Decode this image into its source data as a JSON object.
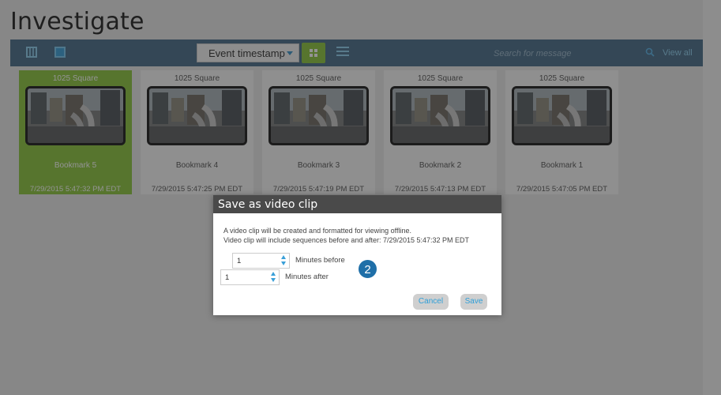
{
  "title": "Investigate",
  "toolbar": {
    "sort_label": "Event timestamp",
    "search_placeholder": "Search for message",
    "view_all": "View all"
  },
  "cards": [
    {
      "camera": "1025 Square",
      "name": "Bookmark 5",
      "time": "7/29/2015 5:47:32 PM EDT",
      "selected": true
    },
    {
      "camera": "1025 Square",
      "name": "Bookmark 4",
      "time": "7/29/2015 5:47:25 PM EDT",
      "selected": false
    },
    {
      "camera": "1025 Square",
      "name": "Bookmark 3",
      "time": "7/29/2015 5:47:19 PM EDT",
      "selected": false
    },
    {
      "camera": "1025 Square",
      "name": "Bookmark 2",
      "time": "7/29/2015 5:47:13 PM EDT",
      "selected": false
    },
    {
      "camera": "1025 Square",
      "name": "Bookmark 1",
      "time": "7/29/2015 5:47:05 PM EDT",
      "selected": false
    }
  ],
  "dialog": {
    "title": "Save as video clip",
    "line1": "A video clip will be created and formatted for viewing offline.",
    "line2": "Video clip will include sequences before and after: 7/29/2015 5:47:32 PM EDT",
    "before_value": "1",
    "before_label": "Minutes before",
    "after_value": "1",
    "after_label": "Minutes after",
    "cancel_label": "Cancel",
    "save_label": "Save"
  },
  "callout": "2",
  "colors": {
    "accent_green": "#8cc63f",
    "toolbar_blue": "#4a6e8a",
    "link_blue": "#2f9fd8",
    "callout_blue": "#1f6fa8"
  },
  "icons": [
    "film-strip-icon",
    "export-icon",
    "grid-view-icon",
    "list-view-icon",
    "search-icon",
    "stepper-up-icon",
    "stepper-down-icon"
  ]
}
